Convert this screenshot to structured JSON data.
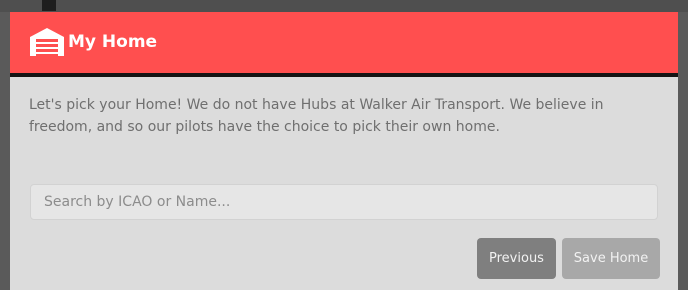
{
  "modal": {
    "title": "My Home",
    "title_icon": "warehouse-garage-icon",
    "description": "Let's pick your Home! We do not have Hubs at Walker Air Transport. We believe in freedom, and so our pilots have the choice to pick their own home.",
    "search": {
      "value": "",
      "placeholder": "Search by ICAO or Name..."
    },
    "buttons": {
      "previous_label": "Previous",
      "save_label": "Save Home"
    }
  },
  "colors": {
    "header_background": "#ff4f4f",
    "modal_background": "#dcdcdc",
    "previous_button": "#7f7f7f",
    "save_button_disabled": "#a8a8a8",
    "body_text": "#6f6f6f"
  }
}
